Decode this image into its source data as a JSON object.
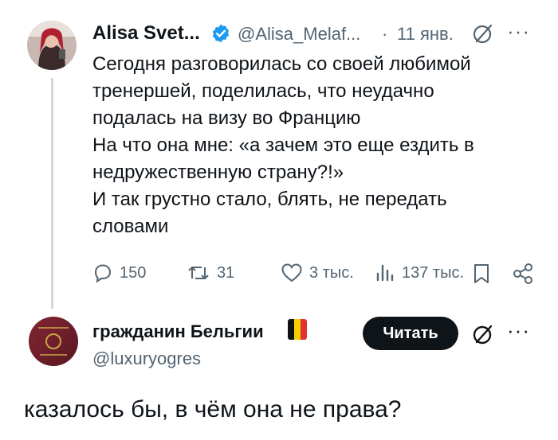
{
  "tweet1": {
    "author_name": "Alisa Svet...",
    "handle": "@Alisa_Melaf...",
    "separator": "·",
    "date": "11 янв.",
    "text_lines": [
      "Сегодня разговорилась со своей любимой",
      "тренершей, поделилась, что неудачно",
      "подалась на визу во Францию",
      "На что она мне: «а зачем это еще ездить в",
      "недружественную страну?!»",
      "И так грустно стало, блять, не передать",
      "словами"
    ],
    "replies": "150",
    "reposts": "31",
    "likes": "3 тыс.",
    "views": "137 тыс."
  },
  "tweet2": {
    "author_name": "гражданин Бельгии",
    "handle": "@luxuryogres",
    "follow_label": "Читать",
    "text": "казалось бы, в чём она не права?"
  },
  "icons": {
    "verified": "verified-badge-icon",
    "grok": "grok-icon",
    "more": "more-icon",
    "reply": "reply-icon",
    "repost": "repost-icon",
    "like": "like-icon",
    "views": "views-icon",
    "bookmark": "bookmark-icon",
    "share": "share-icon",
    "flag": "belgium-flag-icon"
  },
  "colors": {
    "verified": "#1d9bf0",
    "text": "#0f1419",
    "secondary": "#536471",
    "follow_bg": "#0f1419"
  }
}
